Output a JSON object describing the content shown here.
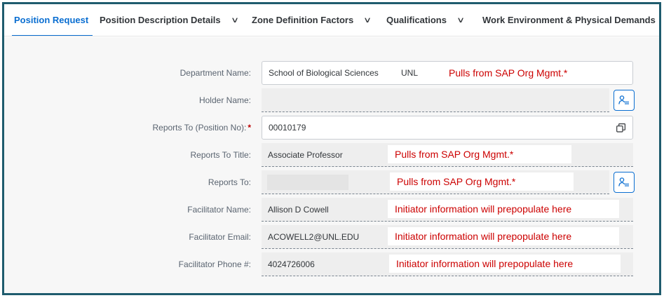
{
  "tabs": [
    {
      "label": "Position Request",
      "active": true,
      "has_dropdown": false
    },
    {
      "label": "Position Description Details",
      "active": false,
      "has_dropdown": true
    },
    {
      "label": "Zone Definition Factors",
      "active": false,
      "has_dropdown": true
    },
    {
      "label": "Qualifications",
      "active": false,
      "has_dropdown": true
    },
    {
      "label": "Work Environment & Physical Demands",
      "active": false,
      "has_dropdown": false
    }
  ],
  "dropdown_glyph": "∨",
  "form": {
    "department_name": {
      "label": "Department Name:",
      "value": "School of Biological Sciences",
      "value_suffix": "UNL",
      "note": "Pulls from SAP Org Mgmt.*"
    },
    "holder_name": {
      "label": "Holder Name:",
      "value": ""
    },
    "reports_to_position": {
      "label": "Reports To (Position No):",
      "required_mark": "*",
      "value": "00010179"
    },
    "reports_to_title": {
      "label": "Reports To Title:",
      "value": "Associate Professor",
      "note": "Pulls from SAP Org Mgmt.*"
    },
    "reports_to": {
      "label": "Reports To:",
      "value": "",
      "note": "Pulls from SAP Org Mgmt.*"
    },
    "facilitator_name": {
      "label": "Facilitator Name:",
      "value": "Allison D Cowell",
      "note": "Initiator information will prepopulate here"
    },
    "facilitator_email": {
      "label": "Facilitator Email:",
      "value": "ACOWELL2@UNL.EDU",
      "note": "Initiator information will prepopulate here"
    },
    "facilitator_phone": {
      "label": "Facilitator Phone #:",
      "value": "4024726006",
      "note": "Initiator information will prepopulate here"
    }
  },
  "colors": {
    "accent": "#0a6ed1",
    "annotation": "#cc0000",
    "frame": "#1f5c6e"
  }
}
